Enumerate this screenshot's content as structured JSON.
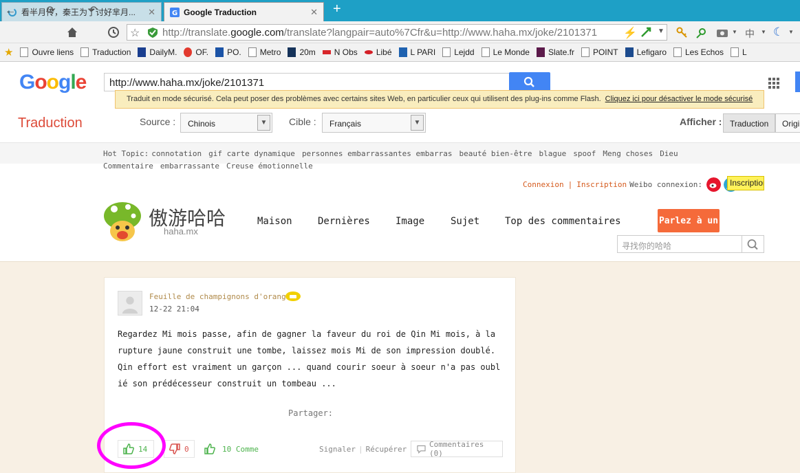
{
  "browser": {
    "tabs": [
      {
        "label": "看半月传，秦王为了讨好芈月...",
        "active": false
      },
      {
        "label": "Google Traduction",
        "active": true
      }
    ],
    "new_tab": "+",
    "url_prefix": "http://translate.",
    "url_domain": "google.com",
    "url_rest": "/translate?langpair=auto%7Cfr&u=http://www.haha.mx/joke/2101371",
    "bookmarks": [
      "Ouvre liens",
      "Traduction",
      "DailyM.",
      "OF.",
      "PO.",
      "Metro",
      "20m",
      "N Obs",
      "Libé",
      "L PARI",
      "Lejdd",
      "Le Monde",
      "Slate.fr",
      "POINT",
      "Lefigaro",
      "Les Echos",
      "L"
    ]
  },
  "translate": {
    "logo": [
      "G",
      "o",
      "o",
      "g",
      "l",
      "e"
    ],
    "logo_colors": [
      "#4285f4",
      "#ea4335",
      "#fbbc05",
      "#4285f4",
      "#34a853",
      "#ea4335"
    ],
    "search_value": "http://www.haha.mx/joke/2101371",
    "security_notice": "Traduit en mode sécurisé. Cela peut poser des problèmes avec certains sites Web, en particulier ceux qui utilisent des plug-ins comme Flash.",
    "security_link": "Cliquez ici pour désactiver le mode sécurisé",
    "title": "Traduction",
    "source_label": "Source :",
    "source_value": "Chinois",
    "target_label": "Cible :",
    "target_value": "Français",
    "show_label": "Afficher :",
    "view_translation": "Traduction",
    "view_original": "Original"
  },
  "site": {
    "hot_topic_label": "Hot Topic:",
    "hot_topics": [
      "connotation",
      "gif carte dynamique",
      "personnes embarrassantes embarras",
      "beauté bien-être",
      "blague",
      "spoof",
      "Meng choses",
      "Dieu Commentaire",
      "embarrassante",
      "Creuse émotionnelle"
    ],
    "login": "Connexion",
    "signup": "Inscription",
    "weibo_login": "Weibo connexion:",
    "signup_button": "Inscription",
    "brand": "傲游哈哈",
    "brand_sub": "haha.mx",
    "menu": [
      "Maison",
      "Dernières",
      "Image",
      "Sujet",
      "Top des commentaires"
    ],
    "talk_button": "Parlez à un",
    "search_placeholder": "寻找你的哈哈"
  },
  "post": {
    "author": "Feuille de champignons d'orange",
    "date": "12-22 21:04",
    "text": "Regardez Mi mois passe, afin de gagner la faveur du roi de Qin Mi mois, à la rupture jaune construit une tombe, laissez mois Mi de son impression doublé. Qin effort est vraiment un garçon ... quand courir soeur à soeur n'a pas oublié son prédécesseur construit un tombeau ...",
    "share_label": "Partager:",
    "upvotes": "14",
    "downvotes": "0",
    "comments_count": "10 Comme",
    "report": "Signaler",
    "recover": "Récupérer",
    "comments_button": "Commentaires (0)"
  },
  "colors": {
    "tabstrip": "#1ea0c6",
    "google_red": "#dd4b39",
    "highlight": "#ff00ff",
    "upvote": "#4db34d",
    "downvote": "#d9534f"
  }
}
